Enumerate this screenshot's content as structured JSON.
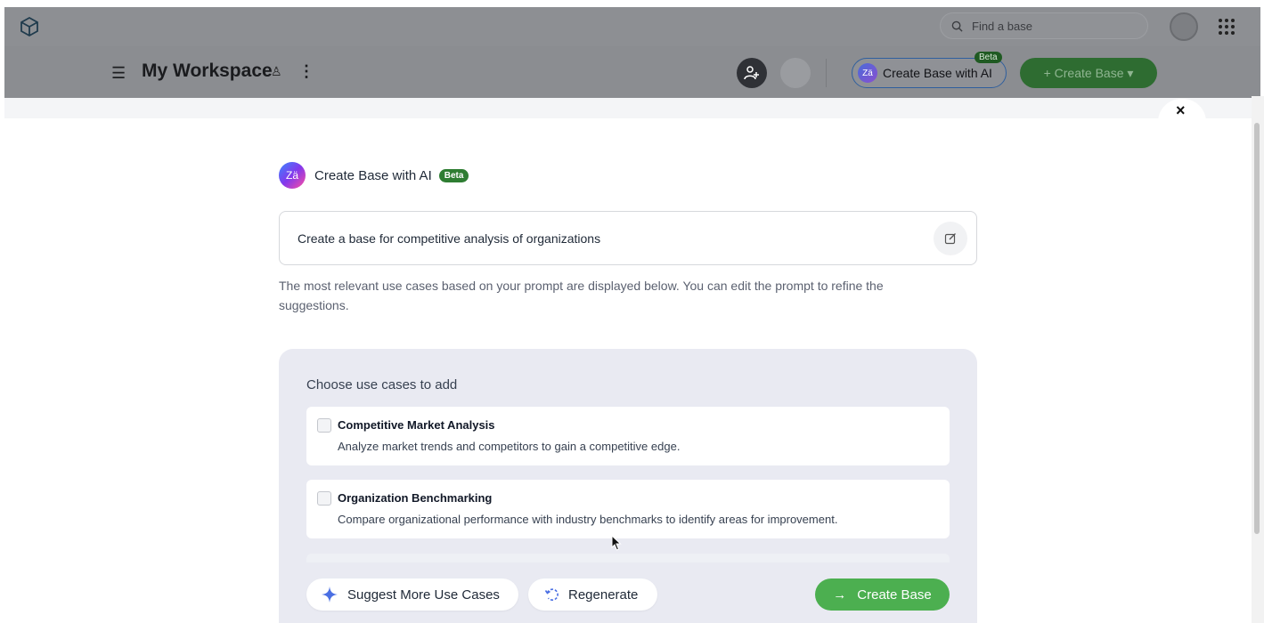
{
  "topbar": {
    "search_placeholder": "Find a base",
    "logo_icon": "cube-logo-icon",
    "apps_icon": "grid-icon"
  },
  "workspace": {
    "title": "My Workspace",
    "create_ai_label": "Create Base with AI",
    "beta_label": "Beta",
    "create_base_label": "+ Create Base ▾"
  },
  "modal": {
    "header_title": "Create Base with AI",
    "beta_label": "Beta",
    "ai_logo_text": "Zä",
    "prompt": "Create a base for competitive analysis of organizations",
    "hint": "The most relevant use cases based on your prompt are displayed below. You can edit the prompt to refine the suggestions.",
    "close_label": "×",
    "panel_title": "Choose use cases to add",
    "use_cases": [
      {
        "title": "Competitive Market Analysis",
        "description": "Analyze market trends and competitors to gain a competitive edge.",
        "checked": false
      },
      {
        "title": "Organization Benchmarking",
        "description": "Compare organizational performance with industry benchmarks to identify areas for improvement.",
        "checked": false
      }
    ],
    "suggest_label": "Suggest More Use Cases",
    "regenerate_label": "Regenerate",
    "create_label": "Create Base"
  },
  "colors": {
    "accent_green": "#4caf50",
    "beta_green": "#2e7d32",
    "panel_bg": "#e9eaf2"
  }
}
